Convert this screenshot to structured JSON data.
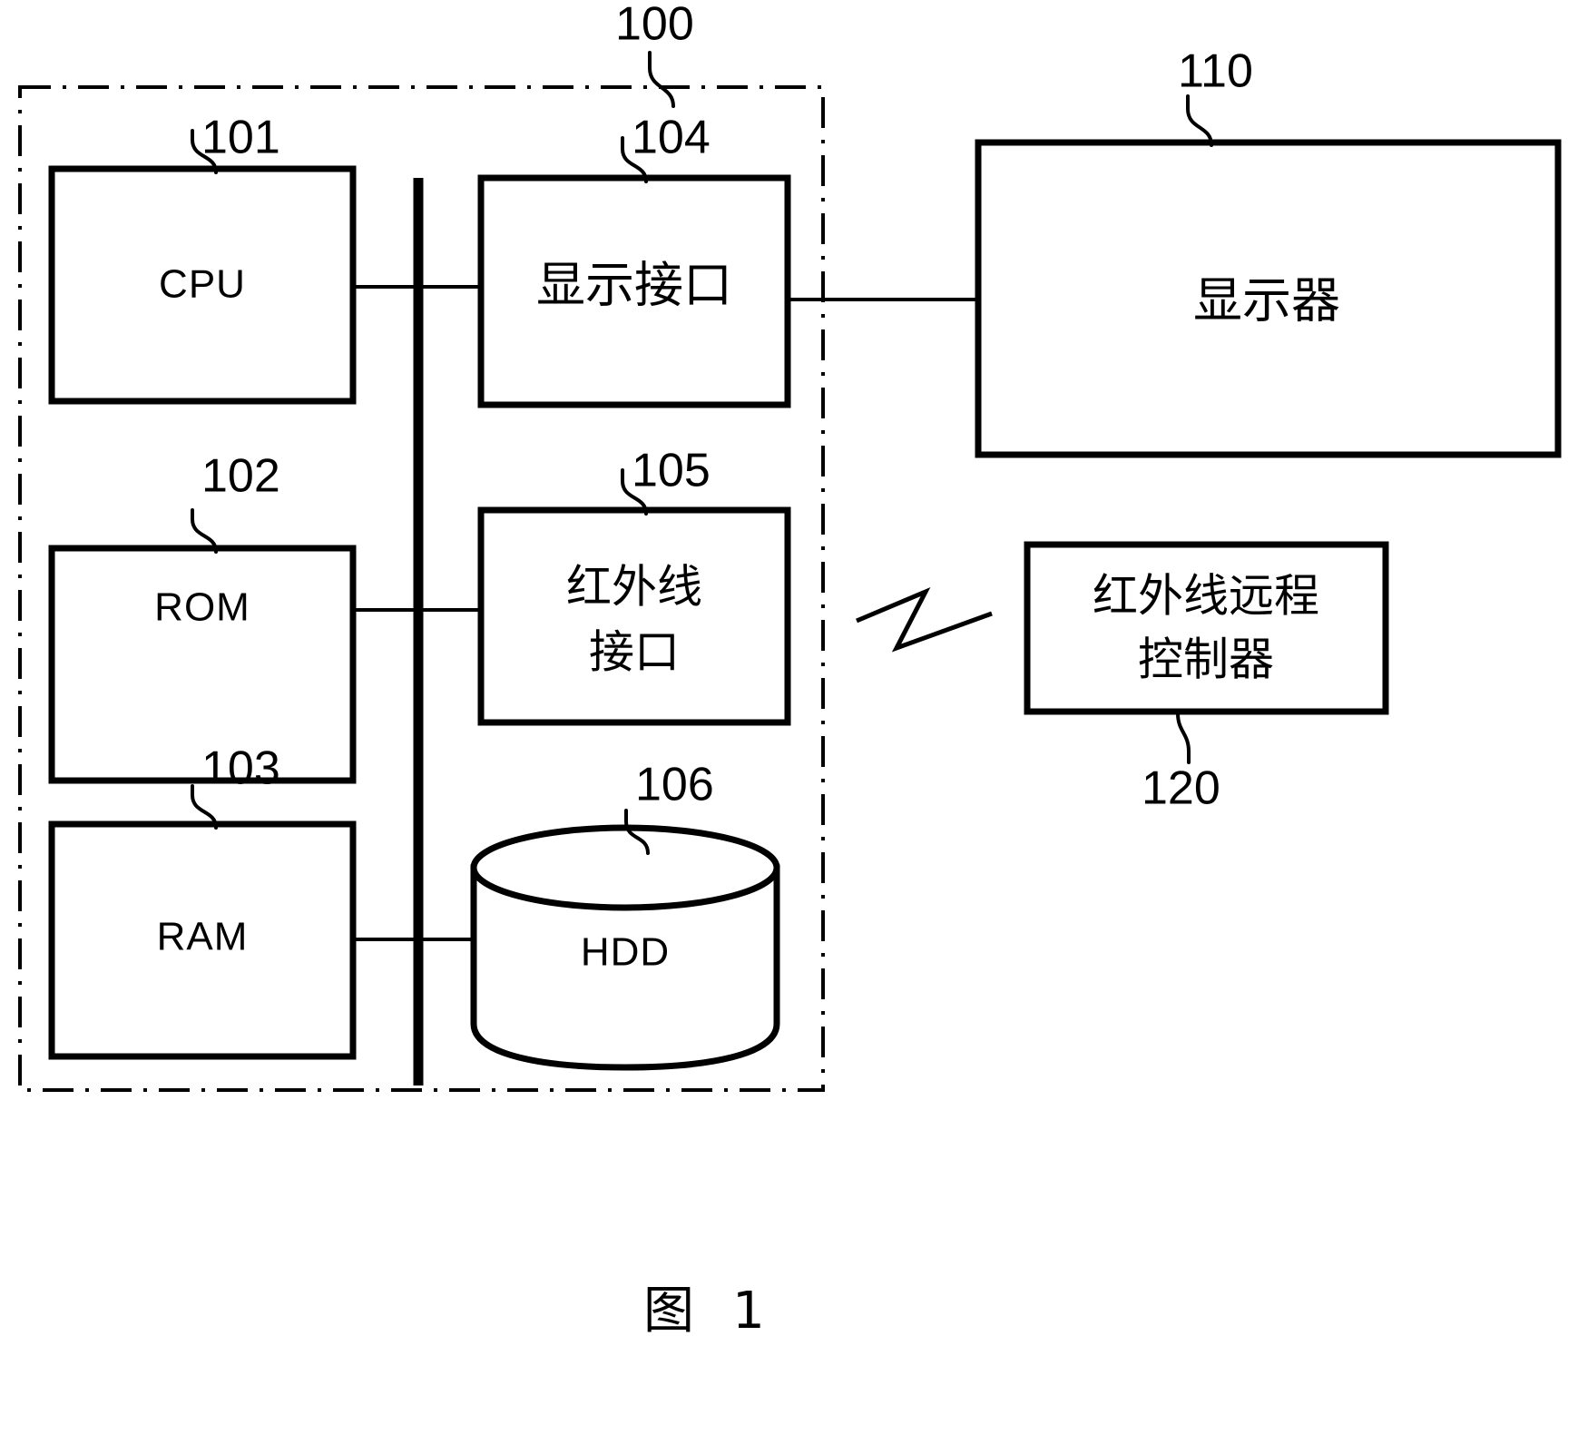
{
  "figure": {
    "caption": "图　1",
    "caption_label": "图",
    "caption_number": "1"
  },
  "system_boundary": {
    "ref": "100",
    "name": "system-enclosure"
  },
  "blocks": [
    {
      "id": "cpu",
      "ref": "101",
      "label": "CPU",
      "label_lines": [
        "CPU"
      ],
      "shape": "rectangle",
      "script": "latin"
    },
    {
      "id": "rom",
      "ref": "102",
      "label": "ROM",
      "label_lines": [
        "ROM"
      ],
      "shape": "rectangle",
      "script": "latin"
    },
    {
      "id": "ram",
      "ref": "103",
      "label": "RAM",
      "label_lines": [
        "RAM"
      ],
      "shape": "rectangle",
      "script": "latin"
    },
    {
      "id": "display-interface",
      "ref": "104",
      "label": "显示接口",
      "label_lines": [
        "显示接口"
      ],
      "shape": "rectangle",
      "script": "cjk"
    },
    {
      "id": "infrared-interface",
      "ref": "105",
      "label": "红外线接口",
      "label_lines": [
        "红外线",
        "接口"
      ],
      "shape": "rectangle",
      "script": "cjk"
    },
    {
      "id": "hdd",
      "ref": "106",
      "label": "HDD",
      "label_lines": [
        "HDD"
      ],
      "shape": "cylinder",
      "script": "latin"
    },
    {
      "id": "display",
      "ref": "110",
      "label": "显示器",
      "label_lines": [
        "显示器"
      ],
      "shape": "rectangle",
      "script": "cjk"
    },
    {
      "id": "infrared-remote-controller",
      "ref": "120",
      "label": "红外线远程控制器",
      "label_lines": [
        "红外线远程",
        "控制器"
      ],
      "shape": "rectangle",
      "script": "cjk"
    }
  ],
  "connections": [
    {
      "from": "cpu",
      "to": "display-interface",
      "kind": "bus-wire"
    },
    {
      "from": "rom",
      "to": "infrared-interface",
      "kind": "bus-wire"
    },
    {
      "from": "ram",
      "to": "hdd",
      "kind": "bus-wire"
    },
    {
      "from": "display-interface",
      "to": "display",
      "kind": "wire"
    },
    {
      "from": "infrared-interface",
      "to": "infrared-remote-controller",
      "kind": "wireless"
    }
  ],
  "colors": {
    "ink": "#000000",
    "paper": "#ffffff"
  }
}
